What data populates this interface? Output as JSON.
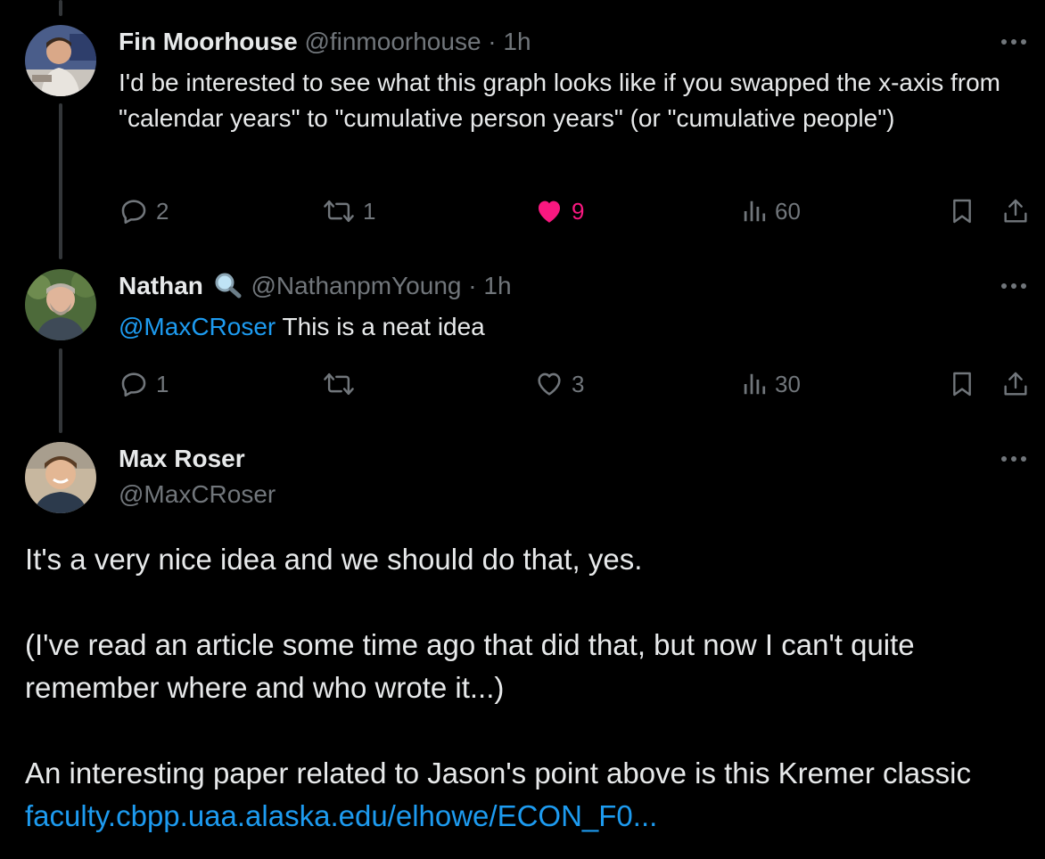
{
  "colors": {
    "background": "#000000",
    "text": "#e7e9ea",
    "muted": "#71767b",
    "link": "#1d9bf0",
    "like": "#f91880"
  },
  "tweets": [
    {
      "name": "Fin Moorhouse",
      "handle": "@finmoorhouse",
      "sep": "·",
      "time": "1h",
      "avatar_icon": "avatar-fin-moorhouse",
      "text": "I'd be interested to see what this graph looks like if you swapped the x-axis from \"calendar years\" to \"cumulative person years\" (or \"cumulative people\")",
      "replies": "2",
      "retweets": "1",
      "likes": "9",
      "liked": true,
      "views": "60"
    },
    {
      "name": "Nathan",
      "name_emoji": "magnifying-glass-icon",
      "handle": "@NathanpmYoung",
      "sep": "·",
      "time": "1h",
      "avatar_icon": "avatar-nathan",
      "mention": "@MaxCRoser",
      "text": "This is a neat idea",
      "replies": "1",
      "retweets": "",
      "likes": "3",
      "liked": false,
      "views": "30"
    }
  ],
  "main_tweet": {
    "name": "Max Roser",
    "handle": "@MaxCRoser",
    "avatar_icon": "avatar-max-roser",
    "paragraph_1": "It's a very nice idea and we should do that, yes.",
    "paragraph_2": "(I've read an article some time ago that did that, but now I can't quite remember where and who wrote it...)",
    "paragraph_3": "An interesting paper related to Jason's point above is this Kremer classic",
    "link": "faculty.cbpp.uaa.alaska.edu/elhowe/ECON_F0..."
  }
}
